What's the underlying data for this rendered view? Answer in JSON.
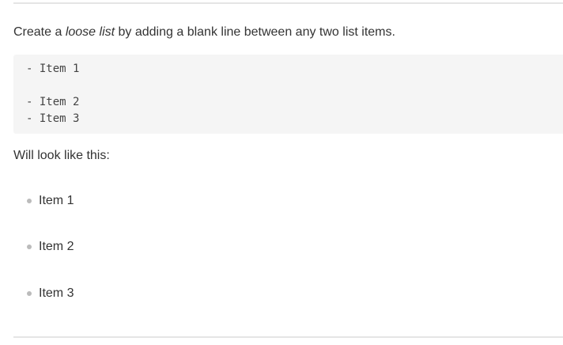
{
  "intro": {
    "before": "Create a ",
    "emphasis": "loose list",
    "after": " by adding a blank line between any two list items."
  },
  "code": {
    "lines": [
      "- Item 1",
      "",
      "- Item 2",
      "- Item 3"
    ]
  },
  "caption": "Will look like this:",
  "rendered_list": {
    "items": [
      "Item 1",
      "Item 2",
      "Item 3"
    ]
  },
  "colors": {
    "code_background": "#f5f5f5",
    "bullet": "#bbbbbb",
    "rule": "#e5e5e5",
    "text": "#333333"
  }
}
